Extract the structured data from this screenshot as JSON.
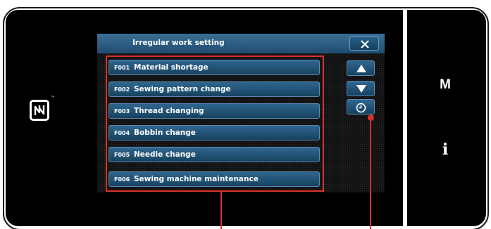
{
  "screen": {
    "title": "Irregular work setting",
    "items": [
      {
        "code": "F001",
        "label": "Material shortage"
      },
      {
        "code": "F002",
        "label": "Sewing pattern change"
      },
      {
        "code": "F003",
        "label": "Thread changing"
      },
      {
        "code": "F004",
        "label": "Bobbin change"
      },
      {
        "code": "F005",
        "label": "Needle change"
      },
      {
        "code": "F006",
        "label": "Sewing machine maintenance"
      }
    ],
    "side_buttons": [
      "scroll-up-icon",
      "scroll-down-icon",
      "clock-icon"
    ],
    "close_icon": "close-icon"
  },
  "device": {
    "nfc_mark": "nfc-icon",
    "nfc_tm": "™",
    "key_m": "M",
    "key_i": "i"
  },
  "colors": {
    "button_top": "#2f668f",
    "button_bottom": "#17425f",
    "callout": "#d9302a"
  }
}
